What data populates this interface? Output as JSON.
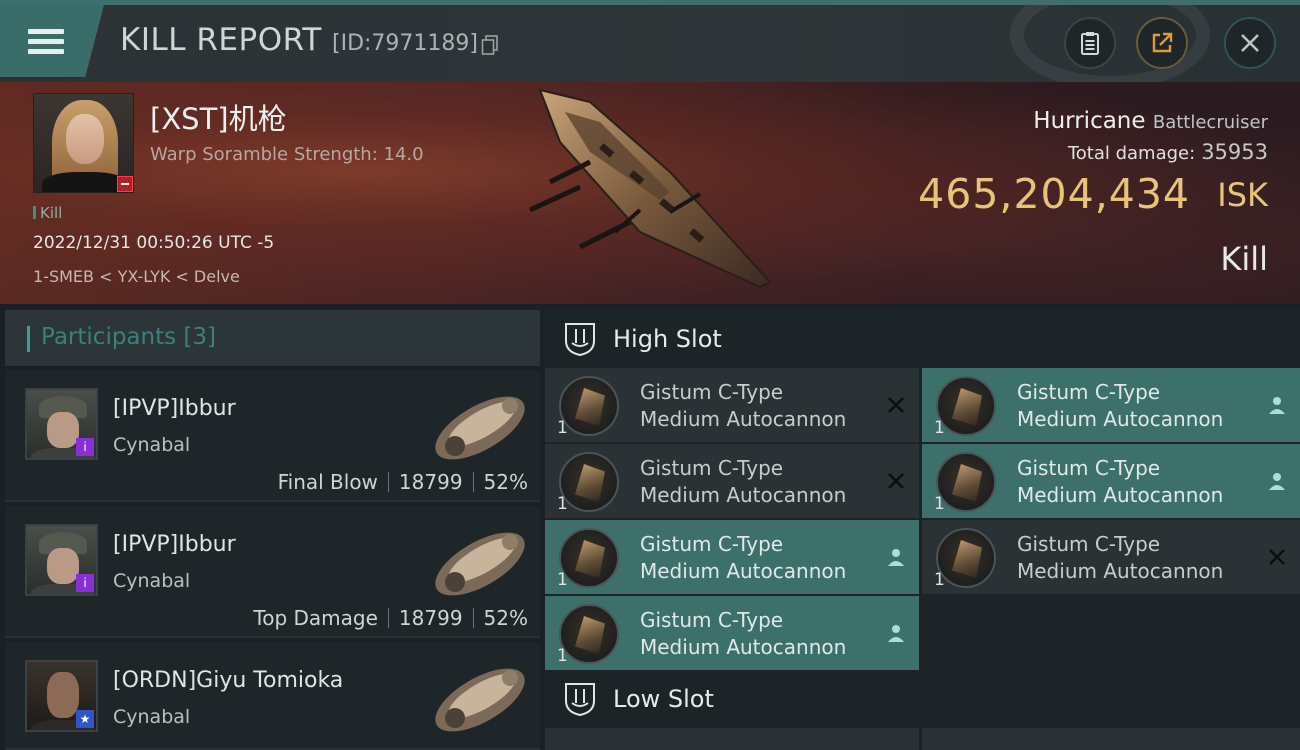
{
  "header": {
    "title": "KILL REPORT",
    "id_text": "[ID:7971189]"
  },
  "victim": {
    "name": "[XST]机枪",
    "warp_scramble": "Warp Soramble Strength: 14.0",
    "status_tag": "Kill",
    "time": "2022/12/31 00:50:26 UTC -5",
    "location": "1-SMEB < YX-LYK < Delve",
    "ship_name": "Hurricane",
    "ship_class": "Battlecruiser",
    "total_damage_label": "Total damage:",
    "total_damage_value": "35953",
    "isk_value": "465,204,434",
    "isk_unit": "ISK",
    "result": "Kill"
  },
  "participants": {
    "header": "Participants [3]",
    "items": [
      {
        "name": "[IPVP]Ibbur",
        "ship": "Cynabal",
        "role": "Final Blow",
        "damage": "18799",
        "percent": "52%",
        "badge": "i"
      },
      {
        "name": "[IPVP]Ibbur",
        "ship": "Cynabal",
        "role": "Top Damage",
        "damage": "18799",
        "percent": "52%",
        "badge": "i"
      },
      {
        "name": "[ORDN]Giyu Tomioka",
        "ship": "Cynabal",
        "badge": "★"
      }
    ]
  },
  "fitting": {
    "high_slot_label": "High Slot",
    "low_slot_label": "Low Slot",
    "high_modules": [
      {
        "line1": "Gistum C-Type",
        "line2": "Medium Autocannon",
        "qty": "1",
        "state": "destroyed"
      },
      {
        "line1": "Gistum C-Type",
        "line2": "Medium Autocannon",
        "qty": "1",
        "state": "dropped"
      },
      {
        "line1": "Gistum C-Type",
        "line2": "Medium Autocannon",
        "qty": "1",
        "state": "destroyed"
      },
      {
        "line1": "Gistum C-Type",
        "line2": "Medium Autocannon",
        "qty": "1",
        "state": "dropped"
      },
      {
        "line1": "Gistum C-Type",
        "line2": "Medium Autocannon",
        "qty": "1",
        "state": "dropped"
      },
      {
        "line1": "Gistum C-Type",
        "line2": "Medium Autocannon",
        "qty": "1",
        "state": "destroyed"
      },
      {
        "line1": "Gistum C-Type",
        "line2": "Medium Autocannon",
        "qty": "1",
        "state": "dropped"
      }
    ]
  },
  "colors": {
    "accent_teal": "#3d706b",
    "isk_gold": "#e8c47b"
  }
}
